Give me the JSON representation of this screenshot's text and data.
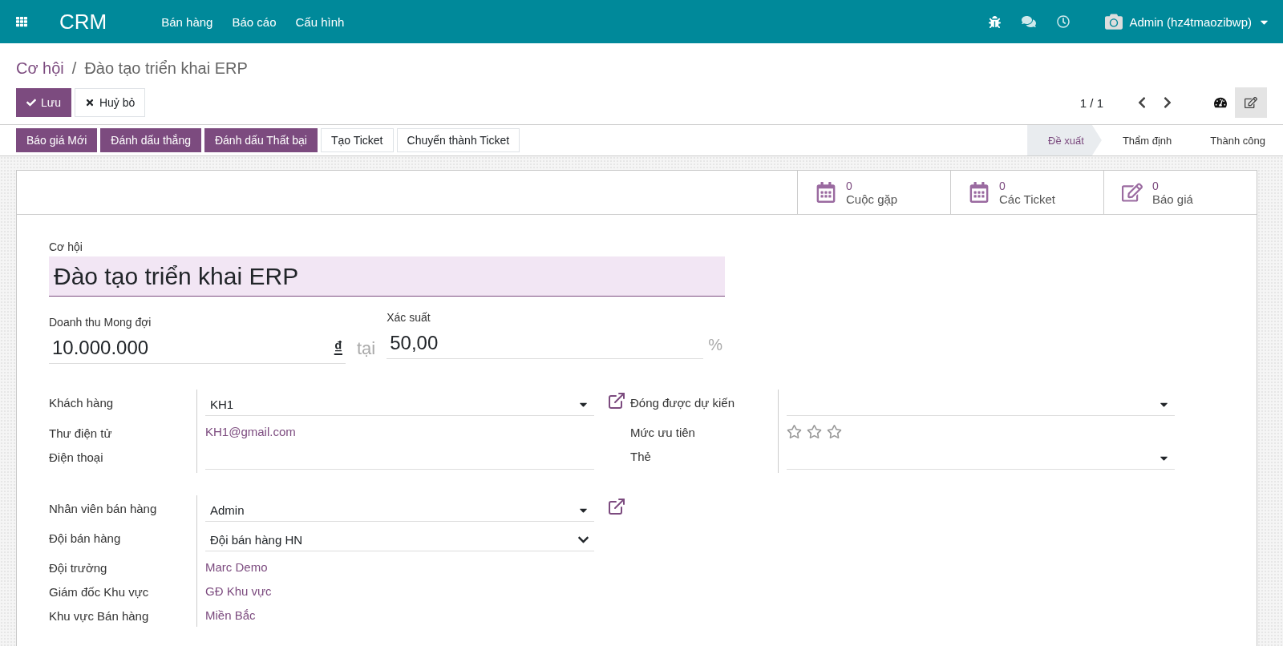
{
  "navbar": {
    "app_name": "CRM",
    "menu": [
      "Bán hàng",
      "Báo cáo",
      "Cấu hình"
    ],
    "user": "Admin (hz4tmaozibwp)"
  },
  "breadcrumb": {
    "parent": "Cơ hội",
    "separator": "/",
    "current": "Đào tạo triển khai ERP"
  },
  "buttons": {
    "save": "Lưu",
    "discard": "Huỷ bỏ"
  },
  "pager": "1 / 1",
  "actions": [
    {
      "label": "Báo giá Mới",
      "kind": "primary"
    },
    {
      "label": "Đánh dấu thắng",
      "kind": "primary"
    },
    {
      "label": "Đánh dấu Thất bại",
      "kind": "primary"
    },
    {
      "label": "Tạo Ticket",
      "kind": "secondary"
    },
    {
      "label": "Chuyển thành Ticket",
      "kind": "secondary"
    }
  ],
  "stages": [
    {
      "label": "Đề xuất",
      "selected": true
    },
    {
      "label": "Thẩm định",
      "selected": false
    },
    {
      "label": "Thành công",
      "selected": false
    }
  ],
  "stat_buttons": [
    {
      "count": "0",
      "label": "Cuộc gặp",
      "kind": "calendar"
    },
    {
      "count": "0",
      "label": "Các Ticket",
      "kind": "calendar"
    },
    {
      "count": "0",
      "label": "Báo giá",
      "kind": "edit"
    }
  ],
  "form": {
    "title_label": "Cơ hội",
    "title": "Đào tạo triển khai ERP",
    "revenue_label": "Doanh thu Mong đợi",
    "revenue": "10.000.000",
    "currency": "₫",
    "at": "tại",
    "probability_label": "Xác suất",
    "probability": "50,00",
    "percent": "%",
    "contact_fields": [
      {
        "label": "Khách hàng",
        "value": "KH1",
        "kind": "select",
        "external_link": true
      },
      {
        "label": "Thư điện tử",
        "value": "KH1@gmail.com",
        "kind": "link"
      },
      {
        "label": "Điện thoại",
        "kind": "input"
      }
    ],
    "side_fields": [
      {
        "label": "Đóng được dự kiến",
        "kind": "select"
      },
      {
        "label": "Mức ưu tiên",
        "kind": "stars",
        "stars": 0
      },
      {
        "label": "Thẻ",
        "kind": "select"
      }
    ],
    "sales_fields": [
      {
        "label": "Nhân viên bán hàng",
        "value": "Admin",
        "kind": "select",
        "external_link": true
      },
      {
        "label": "Đội bán hàng",
        "value": "Đội bán hàng HN",
        "kind": "dropdown"
      },
      {
        "label": "Đội trưởng",
        "value": "Marc Demo",
        "kind": "link"
      },
      {
        "label": "Giám đốc Khu vực",
        "value": "GĐ Khu vực",
        "kind": "link"
      },
      {
        "label": "Khu vực Bán hàng",
        "value": "Miền Bắc",
        "kind": "link"
      }
    ]
  }
}
